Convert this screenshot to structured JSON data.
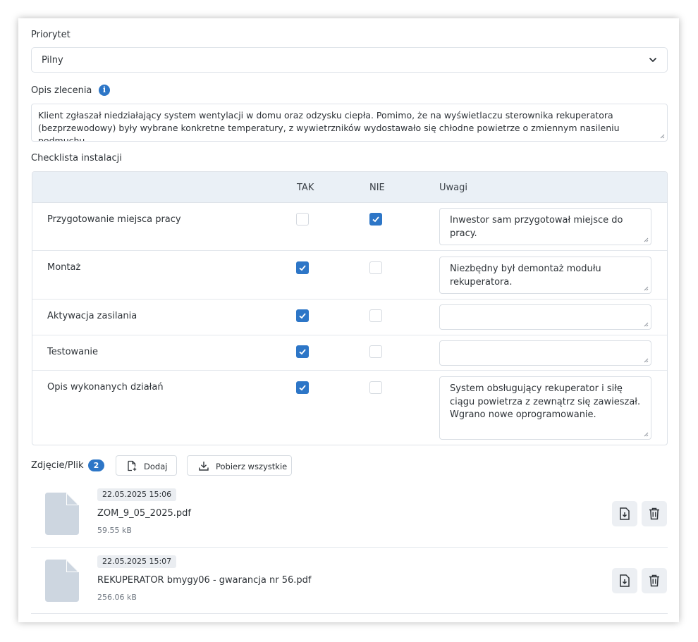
{
  "priority": {
    "label": "Priorytet",
    "value": "Pilny"
  },
  "description": {
    "label": "Opis zlecenia",
    "text": "Klient zgłaszał niedziałający system wentylacji w domu oraz odzysku ciepła. Pomimo, że na wyświetlaczu sterownika rekuperatora (bezprzewodowy) były wybrane konkretne temperatury, z wywietrzników wydostawało się chłodne powietrze o zmiennym nasileniu podmuchu."
  },
  "checklist": {
    "label": "Checklista instalacji",
    "headers": {
      "yes": "TAK",
      "no": "NIE",
      "notes": "Uwagi"
    },
    "rows": [
      {
        "name": "Przygotowanie miejsca pracy",
        "yes": false,
        "no": true,
        "note": "Inwestor sam przygotował miejsce do pracy."
      },
      {
        "name": "Montaż",
        "yes": true,
        "no": false,
        "note": "Niezbędny był demontaż modułu rekuperatora."
      },
      {
        "name": "Aktywacja zasilania",
        "yes": true,
        "no": false,
        "note": ""
      },
      {
        "name": "Testowanie",
        "yes": true,
        "no": false,
        "note": ""
      },
      {
        "name": "Opis wykonanych działań",
        "yes": true,
        "no": false,
        "note": "System obsługujący rekuperator i siłę ciągu powietrza z zewnątrz się zawieszał. Wgrano nowe oprogramowanie."
      }
    ]
  },
  "files": {
    "label": "Zdjęcie/Plik",
    "count": "2",
    "add_label": "Dodaj",
    "download_all_label": "Pobierz wszystkie",
    "items": [
      {
        "date": "22.05.2025 15:06",
        "name": "ZOM_9_05_2025.pdf",
        "size": "59.55 kB"
      },
      {
        "date": "22.05.2025 15:07",
        "name": "REKUPERATOR bmygy06 - gwarancja nr 56.pdf",
        "size": "256.06 kB"
      }
    ]
  },
  "colors": {
    "accent": "#2d76c7",
    "table_header_bg": "#eaf0f6",
    "file_icon": "#cdd6e0"
  }
}
